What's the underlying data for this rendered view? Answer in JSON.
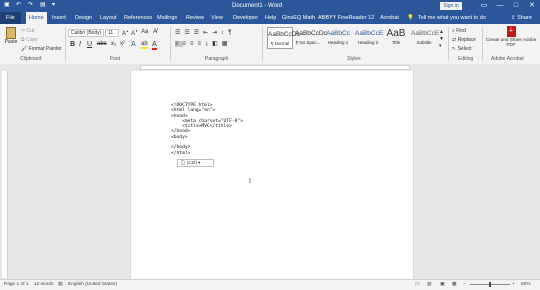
{
  "titlebar": {
    "title": "Document1 - Word",
    "sign_in": "Sign in",
    "minimize": "—",
    "restore": "□",
    "close": "✕"
  },
  "tabs": [
    "File",
    "Home",
    "Insert",
    "Design",
    "Layout",
    "References",
    "Mailings",
    "Review",
    "View",
    "Developer",
    "Help",
    "GinxEQ Math",
    "ABBYY FineReader 12",
    "Acrobat"
  ],
  "tell_me": "Tell me what you want to do",
  "share": "Share",
  "ribbon": {
    "clipboard": {
      "paste": "Paste",
      "cut": "Cut",
      "copy": "Copy",
      "format_painter": "Format Painter",
      "label": "Clipboard"
    },
    "font": {
      "name": "Calibri (Body)",
      "size": "11",
      "label": "Font"
    },
    "paragraph": {
      "label": "Paragraph"
    },
    "styles": {
      "items": [
        {
          "preview": "AaBbCcDc",
          "name": "¶ Normal"
        },
        {
          "preview": "AaBbCcDc",
          "name": "¶ No Spac..."
        },
        {
          "preview": "AaBbCc",
          "name": "Heading 1"
        },
        {
          "preview": "AaBbCcE",
          "name": "Heading 2"
        },
        {
          "preview": "AaB",
          "name": "Title"
        },
        {
          "preview": "AaBbCcE",
          "name": "Subtitle"
        }
      ],
      "label": "Styles"
    },
    "editing": {
      "find": "Find",
      "replace": "Replace",
      "select": "Select",
      "label": "Editing"
    },
    "adobe": {
      "create": "Create and Share Adobe PDF",
      "label": "Adobe Acrobat"
    }
  },
  "document": {
    "code": "<!DOCTYPE html>\n<html lang=\"en\">\n<head>\n    <meta charset=\"UTF-8\">\n    <title>MVC</title>\n</head>\n<body>\n\n</body>\n</html>",
    "paste_options": "(Ctrl)"
  },
  "status": {
    "page": "Page 1 of 1",
    "words": "12 words",
    "language": "English (United States)",
    "zoom": "90%"
  }
}
